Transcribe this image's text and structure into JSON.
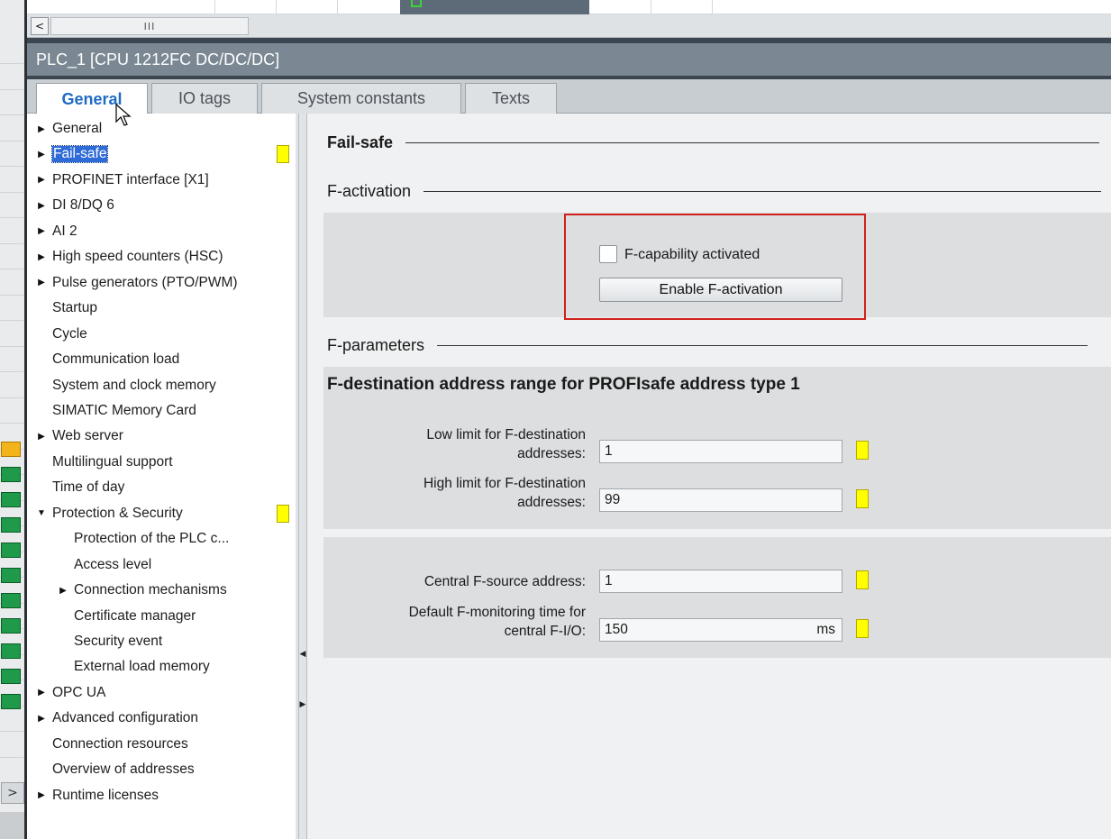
{
  "window": {
    "title": "PLC_1 [CPU 1212FC DC/DC/DC]"
  },
  "hscroll": {
    "thumb_glyph": "III",
    "left_arrow": "<"
  },
  "left_strip": {
    "expand_glyph": ">"
  },
  "tabs": [
    {
      "label": "General",
      "active": true
    },
    {
      "label": "IO tags",
      "active": false
    },
    {
      "label": "System constants",
      "active": false
    },
    {
      "label": "Texts",
      "active": false
    }
  ],
  "nav": {
    "items": [
      {
        "label": "General",
        "arrow": "right",
        "level": 0
      },
      {
        "label": "Fail-safe",
        "arrow": "right",
        "level": 0,
        "selected": true,
        "flag": true
      },
      {
        "label": "PROFINET interface [X1]",
        "arrow": "right",
        "level": 0
      },
      {
        "label": "DI 8/DQ 6",
        "arrow": "right",
        "level": 0
      },
      {
        "label": "AI 2",
        "arrow": "right",
        "level": 0
      },
      {
        "label": "High speed counters (HSC)",
        "arrow": "right",
        "level": 0
      },
      {
        "label": "Pulse generators (PTO/PWM)",
        "arrow": "right",
        "level": 0
      },
      {
        "label": "Startup",
        "arrow": "",
        "level": 0
      },
      {
        "label": "Cycle",
        "arrow": "",
        "level": 0
      },
      {
        "label": "Communication load",
        "arrow": "",
        "level": 0
      },
      {
        "label": "System and clock memory",
        "arrow": "",
        "level": 0
      },
      {
        "label": "SIMATIC Memory Card",
        "arrow": "",
        "level": 0
      },
      {
        "label": "Web server",
        "arrow": "right",
        "level": 0
      },
      {
        "label": "Multilingual support",
        "arrow": "",
        "level": 0
      },
      {
        "label": "Time of day",
        "arrow": "",
        "level": 0
      },
      {
        "label": "Protection & Security",
        "arrow": "down",
        "level": 0,
        "flag": true
      },
      {
        "label": "Protection of the PLC c...",
        "arrow": "",
        "level": 1
      },
      {
        "label": "Access level",
        "arrow": "",
        "level": 1
      },
      {
        "label": "Connection mechanisms",
        "arrow": "right",
        "level": 1
      },
      {
        "label": "Certificate manager",
        "arrow": "",
        "level": 1
      },
      {
        "label": "Security event",
        "arrow": "",
        "level": 1
      },
      {
        "label": "External load memory",
        "arrow": "",
        "level": 1
      },
      {
        "label": "OPC UA",
        "arrow": "right",
        "level": 0
      },
      {
        "label": "Advanced configuration",
        "arrow": "right",
        "level": 0
      },
      {
        "label": "Connection resources",
        "arrow": "",
        "level": 0
      },
      {
        "label": "Overview of addresses",
        "arrow": "",
        "level": 0
      },
      {
        "label": "Runtime licenses",
        "arrow": "right",
        "level": 0
      }
    ]
  },
  "content": {
    "heading": "Fail-safe",
    "f_activation": {
      "heading": "F-activation",
      "checkbox_label": "F-capability activated",
      "checkbox_checked": false,
      "button_label": "Enable F-activation"
    },
    "f_parameters": {
      "heading": "F-parameters",
      "group_title": "F-destination address range for PROFIsafe address type 1",
      "low_limit": {
        "label_line1": "Low limit for F-destination",
        "label_line2": "addresses:",
        "value": "1"
      },
      "high_limit": {
        "label_line1": "High limit for F-destination",
        "label_line2": "addresses:",
        "value": "99"
      },
      "central_source": {
        "label": "Central F-source address:",
        "value": "1"
      },
      "monitoring_time": {
        "label_line1": "Default F-monitoring time for",
        "label_line2": "central F-I/O:",
        "value": "150",
        "unit": "ms"
      }
    }
  },
  "colors": {
    "accent_tab": "#1f6bc4",
    "selection": "#2f6bd6",
    "flag": "#ffff00",
    "highlight_box": "#d0201c"
  }
}
